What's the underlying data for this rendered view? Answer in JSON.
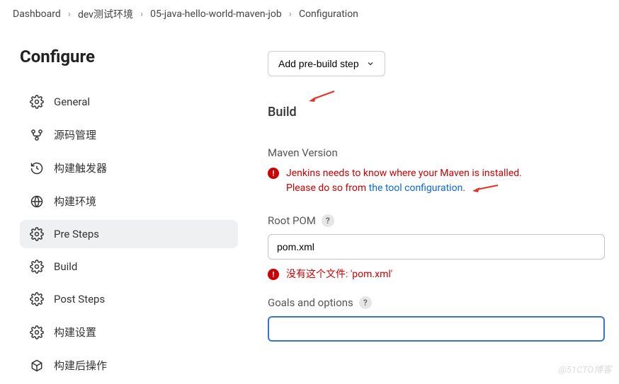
{
  "breadcrumb": {
    "items": [
      "Dashboard",
      "dev测试环境",
      "05-java-hello-world-maven-job",
      "Configuration"
    ]
  },
  "sidebar": {
    "title": "Configure",
    "items": [
      {
        "label": "General"
      },
      {
        "label": "源码管理"
      },
      {
        "label": "构建触发器"
      },
      {
        "label": "构建环境"
      },
      {
        "label": "Pre Steps"
      },
      {
        "label": "Build"
      },
      {
        "label": "Post Steps"
      },
      {
        "label": "构建设置"
      },
      {
        "label": "构建后操作"
      }
    ]
  },
  "main": {
    "add_prebuild_label": "Add pre-build step",
    "build_heading": "Build",
    "maven_version_label": "Maven Version",
    "maven_error_line1": "Jenkins needs to know where your Maven is installed.",
    "maven_error_line2_prefix": "Please do so from ",
    "maven_error_link": "the tool configuration",
    "root_pom_label": "Root POM",
    "root_pom_value": "pom.xml",
    "root_pom_error": "没有这个文件: 'pom.xml'",
    "goals_label": "Goals and options",
    "goals_value": ""
  },
  "watermark": "@51CTO博客"
}
